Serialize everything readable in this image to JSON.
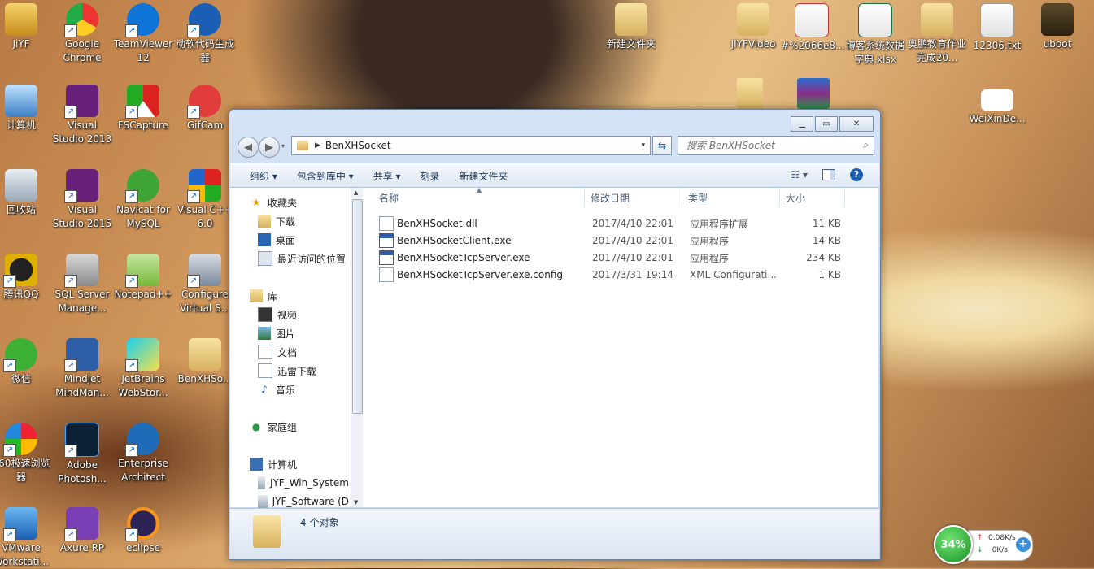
{
  "desktop": {
    "icons": [
      {
        "label": "JiYF"
      },
      {
        "label": "Google Chrome"
      },
      {
        "label": "TeamViewer 12"
      },
      {
        "label": "动软代码生成器"
      },
      {
        "label": "计算机"
      },
      {
        "label": "Visual Studio 2013"
      },
      {
        "label": "FSCapture"
      },
      {
        "label": "GifCam"
      },
      {
        "label": "回收站"
      },
      {
        "label": "Visual Studio 2015"
      },
      {
        "label": "Navicat for MySQL"
      },
      {
        "label": "Visual C++ 6.0"
      },
      {
        "label": "腾讯QQ"
      },
      {
        "label": "SQL Server Manage..."
      },
      {
        "label": "Notepad++"
      },
      {
        "label": "Configure Virtual S..."
      },
      {
        "label": "微信"
      },
      {
        "label": "Mindjet MindMan..."
      },
      {
        "label": "JetBrains WebStor..."
      },
      {
        "label": "BenXHSo..."
      },
      {
        "label": "360极速浏览器"
      },
      {
        "label": "Adobe Photosh..."
      },
      {
        "label": "Enterprise Architect"
      },
      {
        "label": "VMware Workstati..."
      },
      {
        "label": "Axure RP"
      },
      {
        "label": "eclipse"
      },
      {
        "label": "新建文件夹"
      },
      {
        "label": "JIYFVideo"
      },
      {
        "label": "#%2066e8..."
      },
      {
        "label": "博客系统数据字典.xlsx"
      },
      {
        "label": "奥鹏教育作业完成20..."
      },
      {
        "label": "12306.txt"
      },
      {
        "label": "uboot"
      },
      {
        "label": "WeiXinDe..."
      }
    ]
  },
  "explorer": {
    "address": "BenXHSocket",
    "search_placeholder": "搜索 BenXHSocket",
    "commands": [
      "组织 ▾",
      "包含到库中 ▾",
      "共享 ▾",
      "刻录",
      "新建文件夹"
    ],
    "nav": {
      "favorites": "收藏夹",
      "fav_items": [
        "下载",
        "桌面",
        "最近访问的位置"
      ],
      "libraries": "库",
      "lib_items": [
        "视频",
        "图片",
        "文档",
        "迅雷下载",
        "音乐"
      ],
      "homegroup": "家庭组",
      "computer": "计算机",
      "drives": [
        "JYF_Win_System",
        "JYF_Software (D"
      ]
    },
    "columns": [
      "名称",
      "修改日期",
      "类型",
      "大小"
    ],
    "files": [
      {
        "name": "BenXHSocket.dll",
        "date": "2017/4/10 22:01",
        "type": "应用程序扩展",
        "size": "11 KB",
        "icon": "dll-icon"
      },
      {
        "name": "BenXHSocketClient.exe",
        "date": "2017/4/10 22:01",
        "type": "应用程序",
        "size": "14 KB",
        "icon": "exe-icon"
      },
      {
        "name": "BenXHSocketTcpServer.exe",
        "date": "2017/4/10 22:01",
        "type": "应用程序",
        "size": "234 KB",
        "icon": "exe-icon"
      },
      {
        "name": "BenXHSocketTcpServer.exe.config",
        "date": "2017/3/31 19:14",
        "type": "XML Configurati...",
        "size": "1 KB",
        "icon": "config-icon"
      }
    ],
    "status": "4 个对象"
  },
  "net_widget": {
    "percent": "34%",
    "up": "0.08K/s",
    "down": "0K/s"
  }
}
